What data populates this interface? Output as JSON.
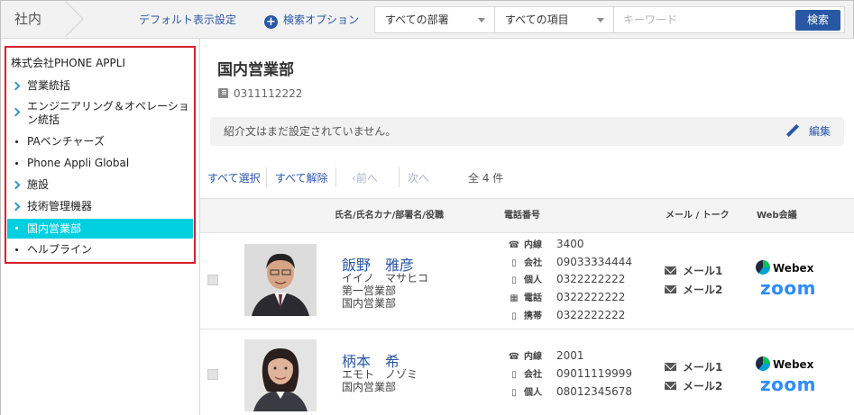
{
  "topbar": {
    "crumb": "社内",
    "default_view": "デフォルト表示設定",
    "search_option": "検索オプション",
    "dept_select": "すべての部署",
    "item_select": "すべての項目",
    "keyword_placeholder": "キーワード",
    "search_btn": "検索"
  },
  "sidebar": {
    "root": "株式会社PHONE APPLI",
    "items": [
      {
        "label": "営業統括",
        "type": "expand"
      },
      {
        "label": "エンジニアリング＆オペレーション統括",
        "type": "expand"
      },
      {
        "label": "PAベンチャーズ",
        "type": "leaf"
      },
      {
        "label": "Phone Appli Global",
        "type": "leaf"
      },
      {
        "label": "施設",
        "type": "expand"
      },
      {
        "label": "技術管理機器",
        "type": "expand"
      },
      {
        "label": "国内営業部",
        "type": "leaf",
        "active": true
      },
      {
        "label": "ヘルプライン",
        "type": "leaf"
      }
    ]
  },
  "main": {
    "title": "国内営業部",
    "phone": "0311112222",
    "intro": "紹介文はまだ設定されていません。",
    "edit": "編集",
    "pager": {
      "select_all": "すべて選択",
      "deselect_all": "すべて解除",
      "prev": "前へ",
      "next": "次へ",
      "count": "全 4 件"
    },
    "columns": {
      "name": "氏名/氏名カナ/部署名/役職",
      "phone": "電話番号",
      "mail": "メール / トーク",
      "web": "Web会議"
    },
    "rows": [
      {
        "name": "飯野　雅彦",
        "kana": "イイノ　マサヒコ",
        "dept1": "第一営業部",
        "dept2": "国内営業部",
        "tels": [
          {
            "icon": "phone-icon",
            "label": "内線",
            "value": "3400"
          },
          {
            "icon": "mobile-icon",
            "label": "会社",
            "value": "09033334444"
          },
          {
            "icon": "mobile-icon",
            "label": "個人",
            "value": "0322222222"
          },
          {
            "icon": "fax-icon",
            "label": "電話",
            "value": "0322222222"
          },
          {
            "icon": "mobile-icon",
            "label": "携帯",
            "value": "0322222222"
          }
        ],
        "mail1": "メール1",
        "mail2": "メール2",
        "webex": "Webex",
        "zoom": "zoom"
      },
      {
        "name": "柄本　希",
        "kana": "エモト　ノゾミ",
        "dept1": "国内営業部",
        "tels": [
          {
            "icon": "phone-icon",
            "label": "内線",
            "value": "2001"
          },
          {
            "icon": "mobile-icon",
            "label": "会社",
            "value": "09011119999"
          },
          {
            "icon": "mobile-icon",
            "label": "個人",
            "value": "08012345678"
          }
        ],
        "mail1": "メール1",
        "mail2": "メール2",
        "webex": "Webex",
        "zoom": "zoom"
      }
    ]
  }
}
